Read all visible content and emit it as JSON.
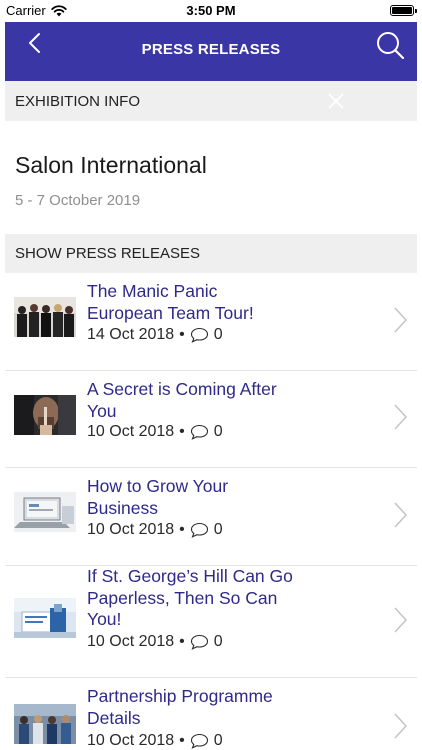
{
  "status_bar": {
    "carrier": "Carrier",
    "time": "3:50 PM"
  },
  "nav": {
    "title": "PRESS RELEASES",
    "back_icon": "chevron-left-icon",
    "search_icon": "search-icon",
    "background_color": "#3b36a6"
  },
  "exhibition_info": {
    "label": "EXHIBITION INFO",
    "close_icon": "close-icon",
    "name": "Salon International",
    "dates": "5 - 7 October 2019"
  },
  "press_releases": {
    "section_label": "SHOW PRESS RELEASES",
    "title_color": "#2f2a8a",
    "items": [
      {
        "title": "The Manic Panic European Team Tour!",
        "date": "14 Oct 2018",
        "separator": "•",
        "comments": "0"
      },
      {
        "title": "A Secret is Coming After You",
        "date": "10 Oct 2018",
        "separator": "•",
        "comments": "0"
      },
      {
        "title": "How to Grow Your Business",
        "date": "10 Oct 2018",
        "separator": "•",
        "comments": "0"
      },
      {
        "title": "If St. George’s Hill Can Go Paperless, Then So Can You!",
        "date": "10 Oct 2018",
        "separator": "•",
        "comments": "0"
      },
      {
        "title": "Partnership Programme Details",
        "date": "10 Oct 2018",
        "separator": "•",
        "comments": "0"
      }
    ]
  }
}
